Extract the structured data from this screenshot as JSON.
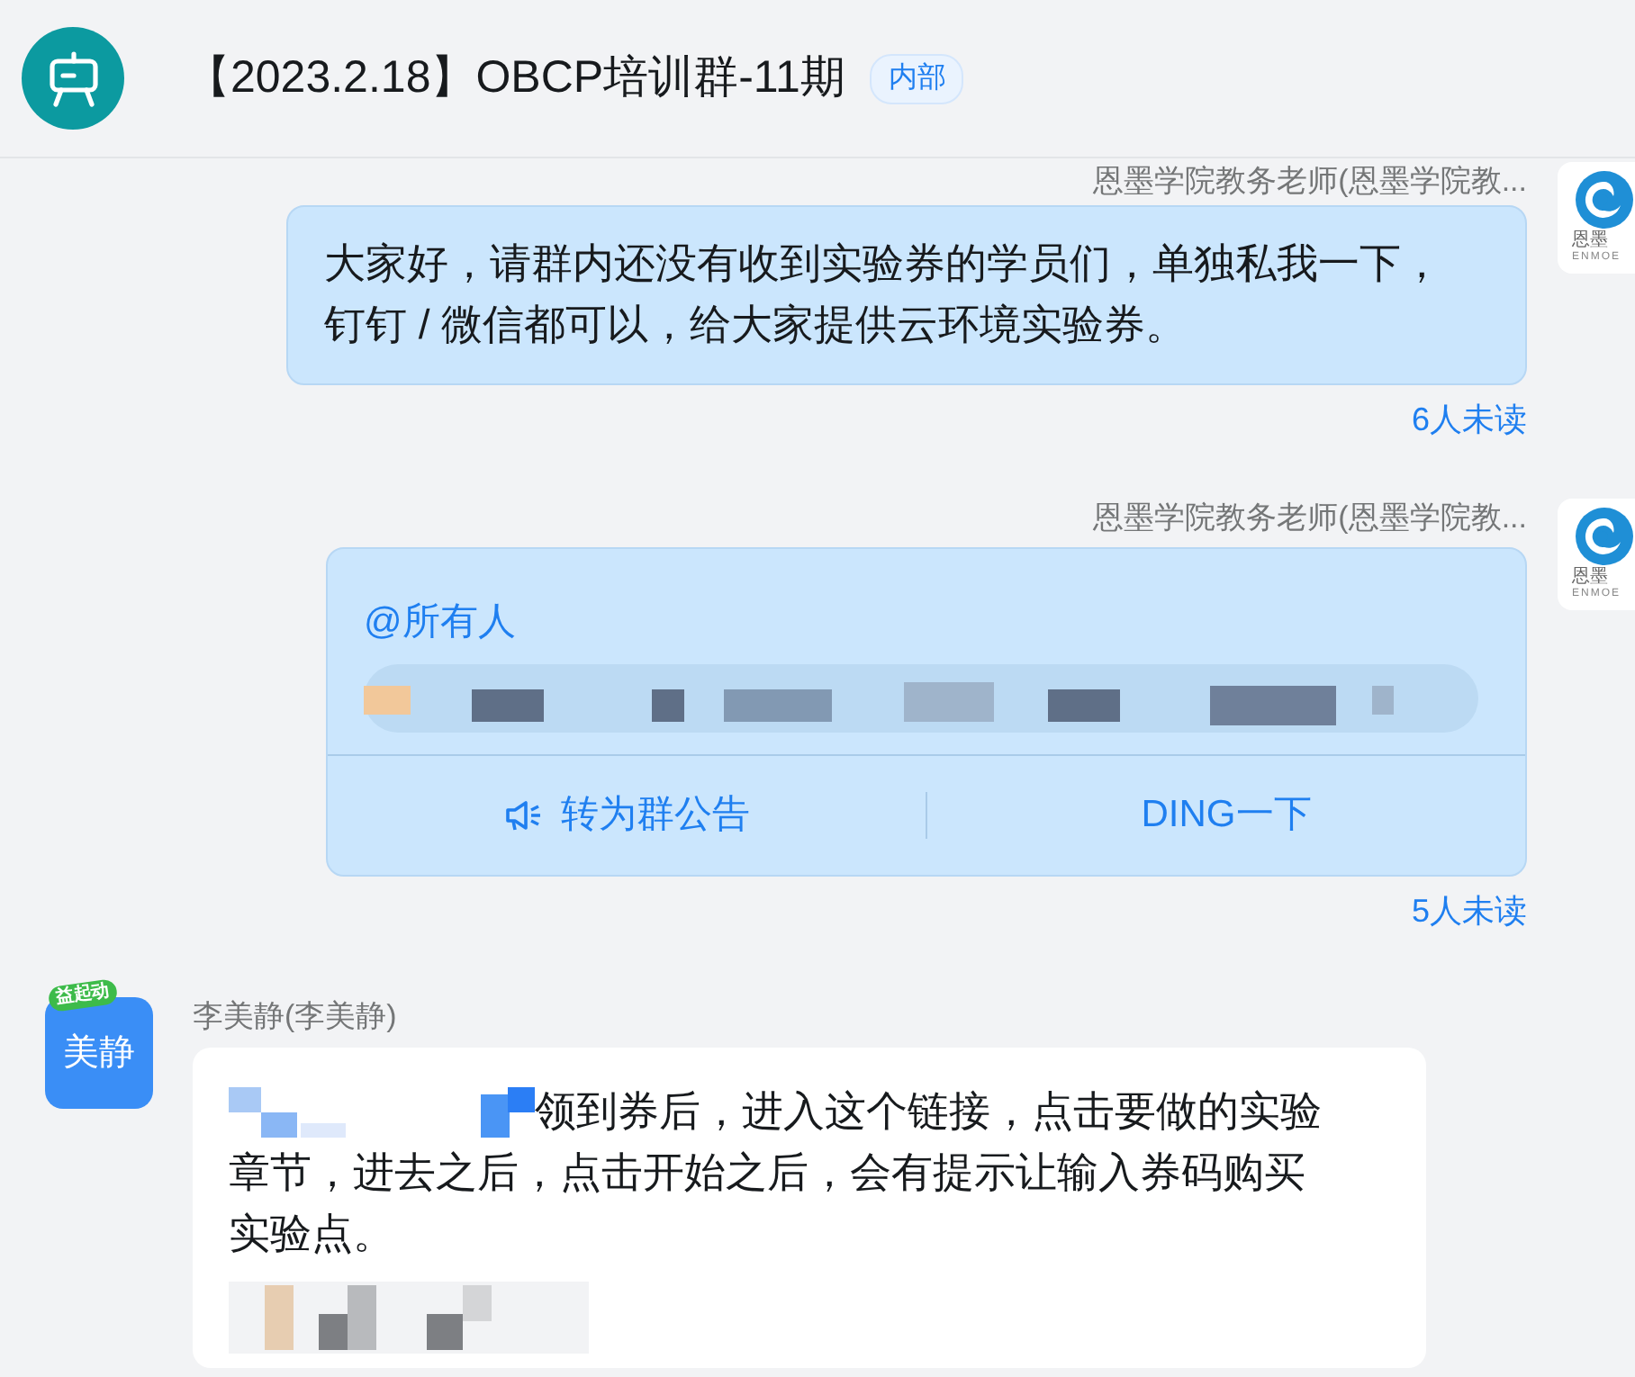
{
  "header": {
    "title": "【2023.2.18】OBCP培训群-11期",
    "tag": "内部"
  },
  "messages": [
    {
      "kind": "text",
      "mine": true,
      "sender": "恩墨学院教务老师(恩墨学院教...",
      "avatar": {
        "kind": "logo",
        "logo_text": "恩墨",
        "logo_subtext": "ENMOE"
      },
      "text": "大家好，请群内还没有收到实验券的学员们，单独私我一下，钉钉 / 微信都可以，给大家提供云环境实验券。",
      "read_status": "6人未读"
    },
    {
      "kind": "ding",
      "mine": true,
      "sender": "恩墨学院教务老师(恩墨学院教...",
      "avatar": {
        "kind": "logo",
        "logo_text": "恩墨",
        "logo_subtext": "ENMOE"
      },
      "mention": "@所有人",
      "actions": [
        {
          "kind": "announce",
          "label": "转为群公告"
        },
        {
          "kind": "ding",
          "label": "DING一下"
        }
      ],
      "read_status": "5人未读"
    },
    {
      "kind": "text",
      "mine": false,
      "sender": "李美静(李美静)",
      "avatar": {
        "kind": "initials",
        "initials": "美静",
        "badge": "益起动"
      },
      "redacted_prefix": true,
      "text": "领到券后，进入这个链接，点击要做的实验章节，进去之后，点击开始之后，会有提示让输入券码购买实验点。",
      "redacted_link": true
    }
  ]
}
